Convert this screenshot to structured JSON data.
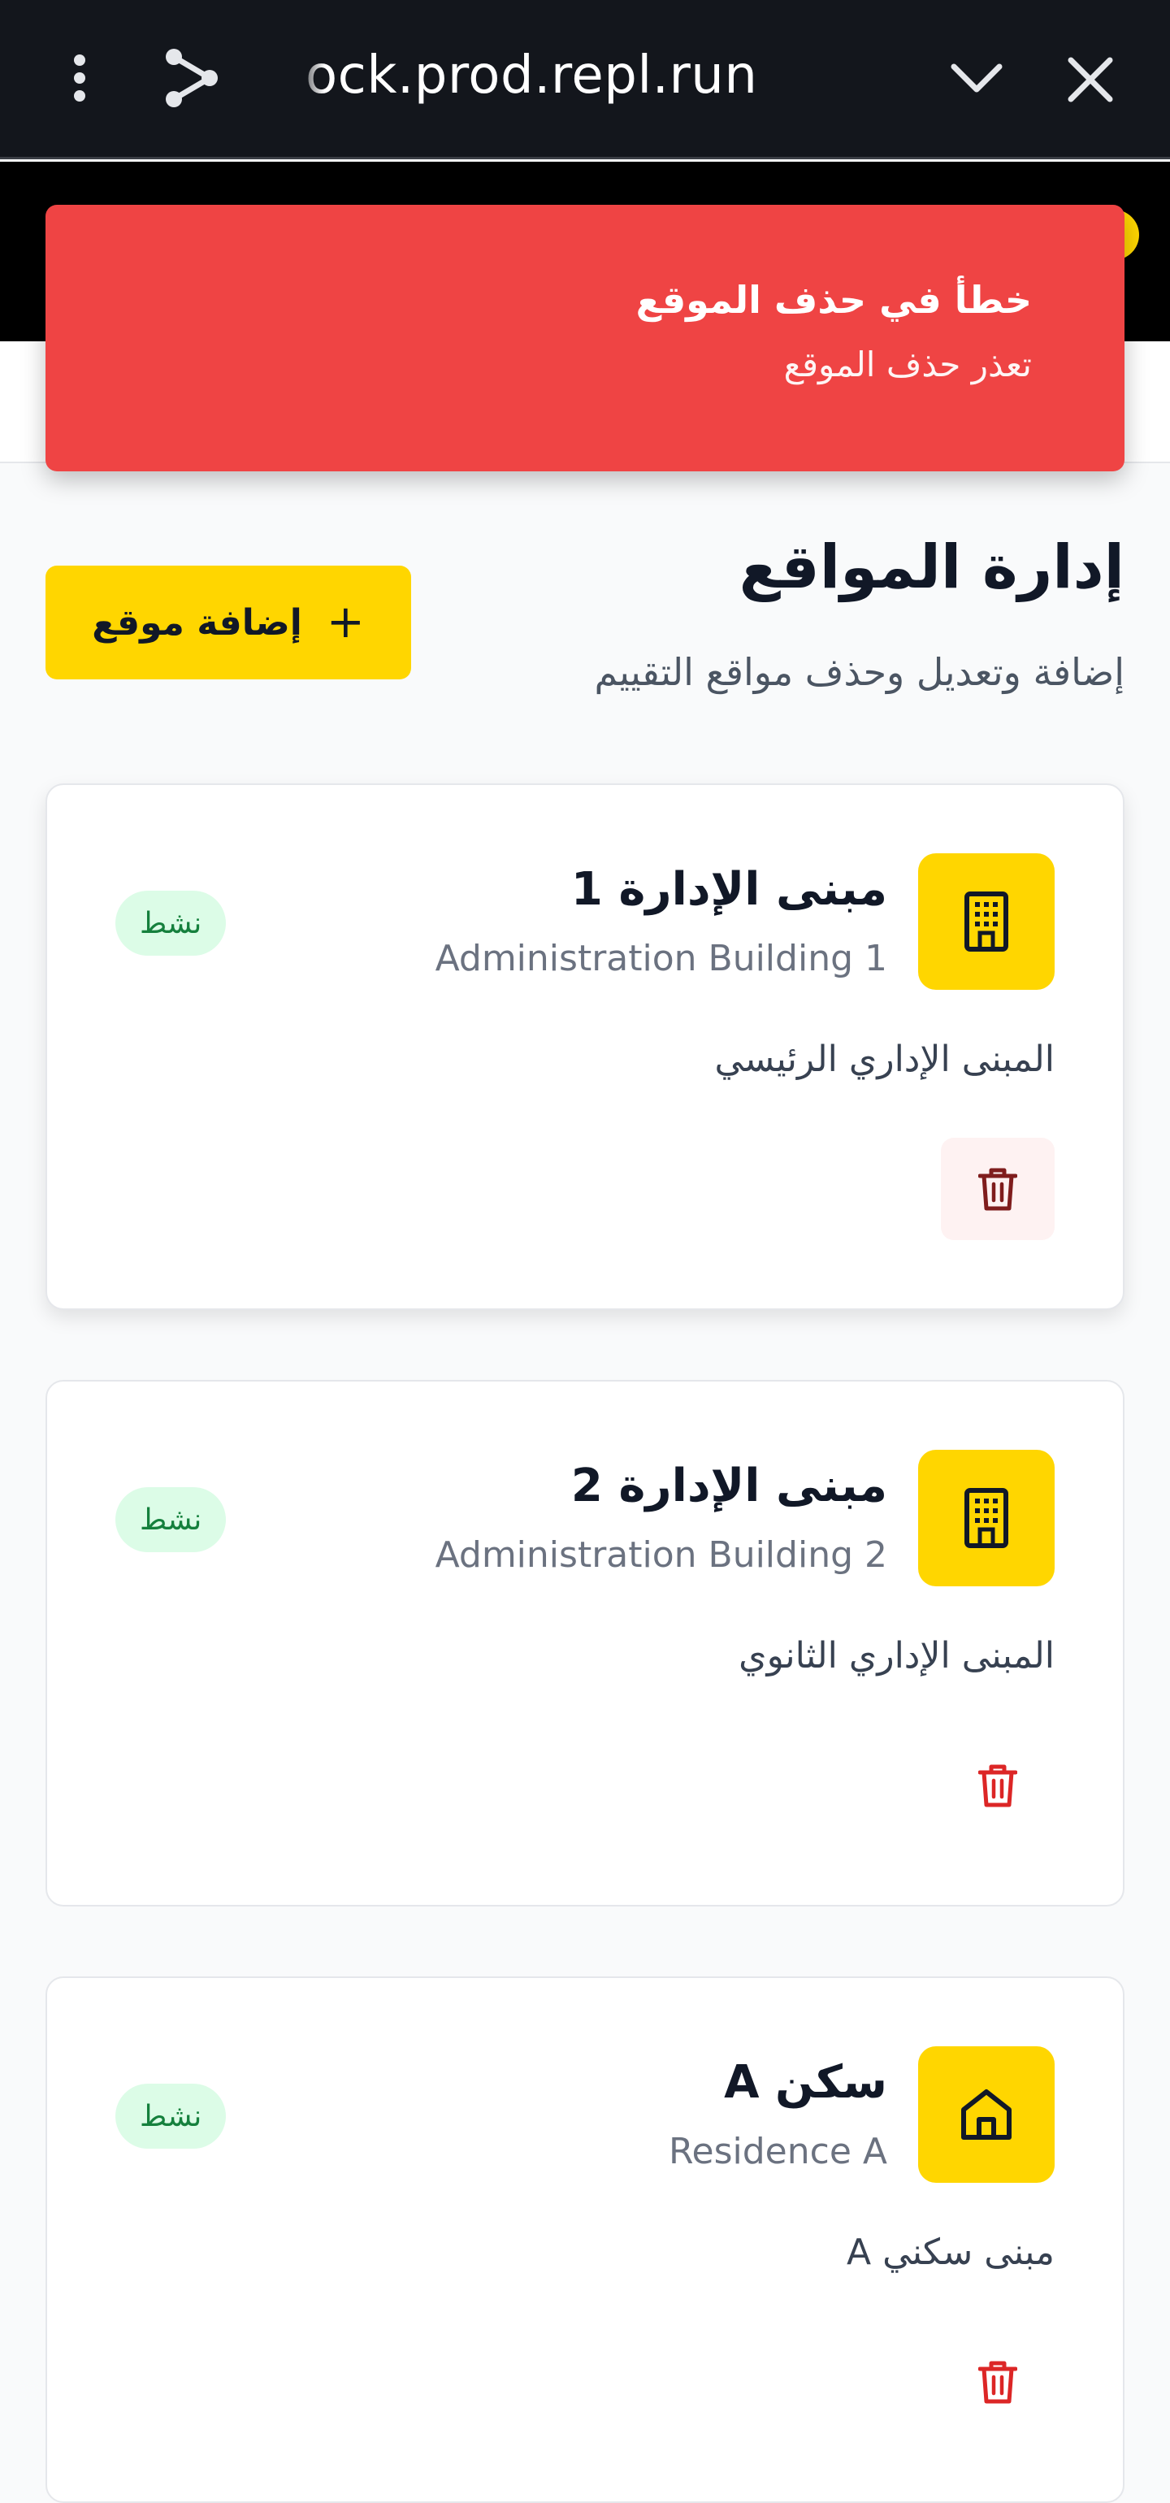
{
  "browser": {
    "url": "ock.prod.repl.run"
  },
  "toast": {
    "title": "خطأ في حذف الموقع",
    "message": "تعذر حذف الموقع"
  },
  "page": {
    "title": "إدارة المواقع",
    "subtitle": "إضافة وتعديل وحذف مواقع التقييم",
    "add_button_label": "إضافة موقع",
    "add_button_icon": "+"
  },
  "locations": [
    {
      "name_ar": "مبنى الإدارة 1",
      "name_en": "Administration Building 1",
      "description": "المبنى الإداري الرئيسي",
      "status": "نشط",
      "icon": "building-icon"
    },
    {
      "name_ar": "مبنى الإدارة 2",
      "name_en": "Administration Building 2",
      "description": "المبنى الإداري الثانوي",
      "status": "نشط",
      "icon": "building-icon"
    },
    {
      "name_ar": "سكن A",
      "name_en": "Residence A",
      "description": "مبنى سكني A",
      "status": "نشط",
      "icon": "home-icon"
    }
  ],
  "colors": {
    "accent": "#ffd600",
    "error": "#ef4444",
    "active_badge_bg": "#dcfce7",
    "active_badge_text": "#15803d",
    "delete": "#dc2626"
  }
}
